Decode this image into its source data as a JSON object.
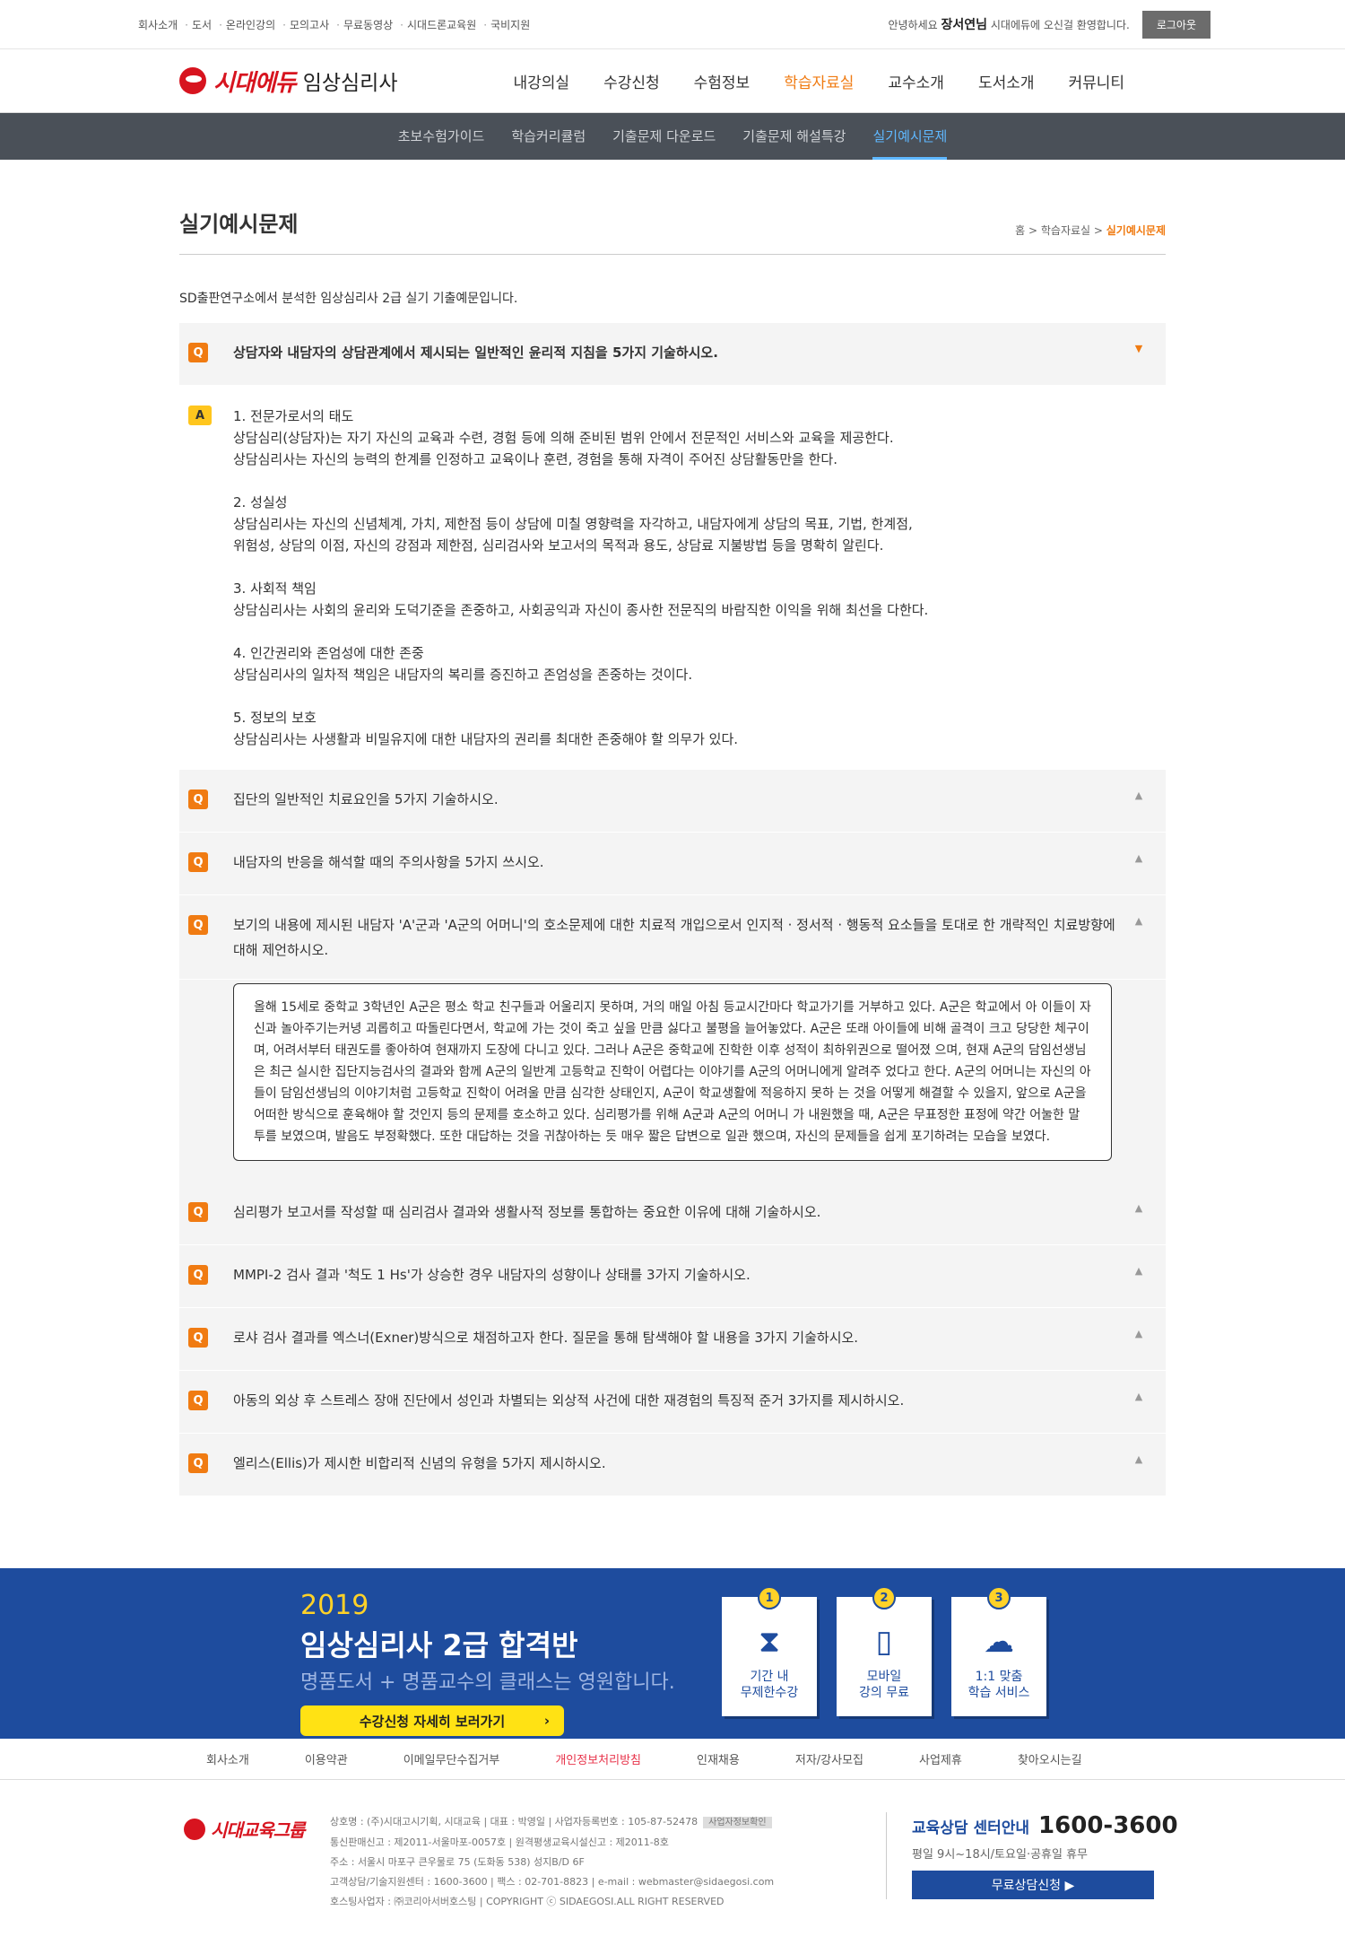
{
  "topbar": {
    "links": [
      "회사소개",
      "도서",
      "온라인강의",
      "모의고사",
      "무료동영상",
      "시대드론교육원",
      "국비지원"
    ],
    "greeting_pre": "안녕하세요",
    "user_name": "장서연님",
    "greeting_post": "시대에듀에 오신걸 환영합니다.",
    "logout_label": "로그아웃"
  },
  "header": {
    "logo_text": "시대에듀",
    "logo_sub": "임상심리사",
    "menu": [
      "내강의실",
      "수강신청",
      "수험정보",
      "학습자료실",
      "교수소개",
      "도서소개",
      "커뮤니티"
    ]
  },
  "subnav": [
    "초보수험가이드",
    "학습커리큘럼",
    "기출문제 다운로드",
    "기출문제 해설특강",
    "실기예시문제"
  ],
  "page": {
    "title": "실기예시문제",
    "breadcrumb": [
      "홈",
      "학습자료실",
      "실기예시문제"
    ],
    "intro": "SD출판연구소에서 분석한 임상심리사 2급 실기 기출예문입니다."
  },
  "faq": {
    "q_badge": "Q",
    "a_badge": "A",
    "open_arrow": "▼",
    "closed_arrow": "▲",
    "items": [
      {
        "q": "상담자와 내담자의 상담관계에서 제시되는 일반적인 윤리적 지침을 5가지 기술하시오."
      },
      {
        "q": "집단의 일반적인 치료요인을 5가지 기술하시오."
      },
      {
        "q": "내담자의 반응을 해석할 때의 주의사항을 5가지 쓰시오."
      },
      {
        "q": "보기의 내용에 제시된 내담자 'A'군과 'A군의 어머니'의 호소문제에 대한 치료적 개입으로서 인지적 · 정서적 · 행동적 요소들을 토대로 한 개략적인 치료방향에 대해 제언하시오."
      },
      {
        "q": "심리평가 보고서를 작성할 때 심리검사 결과와 생활사적 정보를 통합하는 중요한 이유에 대해 기술하시오."
      },
      {
        "q": "MMPI-2 검사 결과 '척도 1 Hs'가 상승한 경우 내담자의 성향이나 상태를 3가지 기술하시오."
      },
      {
        "q": "로샤 검사 결과를 엑스너(Exner)방식으로 채점하고자 한다. 질문을 통해 탐색해야 할 내용을 3가지 기술하시오."
      },
      {
        "q": "아동의 외상 후 스트레스 장애 진단에서 성인과 차별되는 외상적 사건에 대한 재경험의 특징적 준거 3가지를 제시하시오."
      },
      {
        "q": "엘리스(Ellis)가 제시한 비합리적 신념의 유형을 5가지 제시하시오."
      }
    ],
    "answer": [
      {
        "h": "1. 전문가로서의 태도",
        "lines": [
          "상담심리(상담자)는 자기 자신의 교육과 수련, 경험 등에 의해 준비된 범위 안에서 전문적인 서비스와 교육을 제공한다.",
          "상담심리사는 자신의 능력의 한계를 인정하고 교육이나 훈련, 경험을 통해 자격이 주어진 상담활동만을 한다."
        ]
      },
      {
        "h": "2. 성실성",
        "lines": [
          "상담심리사는 자신의 신념체계, 가치, 제한점 등이 상담에 미칠 영향력을 자각하고, 내담자에게 상담의 목표, 기법, 한계점,",
          "위험성, 상담의 이점, 자신의 강점과 제한점, 심리검사와 보고서의 목적과 용도, 상담료 지불방법 등을 명확히 알린다."
        ]
      },
      {
        "h": "3. 사회적 책임",
        "lines": [
          "상담심리사는 사회의 윤리와 도덕기준을 존중하고, 사회공익과 자신이 종사한 전문직의 바람직한 이익을 위해 최선을 다한다."
        ]
      },
      {
        "h": "4. 인간권리와 존엄성에 대한 존중",
        "lines": [
          "상담심리사의 일차적 책임은 내담자의 복리를 증진하고 존엄성을 존중하는 것이다."
        ]
      },
      {
        "h": "5. 정보의 보호",
        "lines": [
          "상담심리사는 사생활과 비밀유지에 대한 내담자의 권리를 최대한 존중해야 할 의무가 있다."
        ]
      }
    ],
    "case_lines": [
      "올해 15세로 중학교 3학년인 A군은 평소 학교 친구들과 어울리지 못하며, 거의 매일 아침 등교시간마다 학교가기를 거부하고 있다. A군은 학교에서 아",
      "이들이 자신과 놀아주기는커녕 괴롭히고 따돌린다면서, 학교에 가는 것이 죽고 싶을 만큼 싫다고 불평을 늘어놓았다. A군은 또래 아이들에 비해 골격이",
      "크고 당당한 체구이며, 어려서부터 태권도를 좋아하여 현재까지 도장에 다니고 있다. 그러나 A군은 중학교에 진학한 이후 성적이 최하위권으로 떨어졌",
      "으며, 현재 A군의 담임선생님은 최근 실시한 집단지능검사의 결과와 함께 A군의 일반계 고등학교 진학이 어렵다는 이야기를 A군의 어머니에게 알려주",
      "었다고 한다. A군의 어머니는 자신의 아들이 담임선생님의 이야기처럼 고등학교 진학이 어려울 만큼 심각한 상태인지, A군이 학교생활에 적응하지 못하",
      "는 것을 어떻게 해결할 수 있을지, 앞으로 A군을 어떠한 방식으로 훈육해야 할 것인지 등의 문제를 호소하고 있다. 심리평가를 위해 A군과 A군의 어머니",
      "가 내원했을 때, A군은 무표정한 표정에 약간 어눌한 말투를 보였으며, 발음도 부정확했다. 또한 대답하는 것을 귀찮아하는 듯 매우 짧은 답변으로 일관",
      "했으며, 자신의 문제들을 쉽게 포기하려는 모습을 보였다."
    ]
  },
  "banner": {
    "year": "2019",
    "title": "임상심리사 2급 합격반",
    "sub": "명품도서 + 명품교수의 클래스는 영원합니다.",
    "button": "수강신청 자세히 보러가기",
    "button_arrow": "›",
    "cards": [
      {
        "num": "1",
        "icon": "hourglass-icon",
        "glyph": "⧗",
        "l1": "기간 내",
        "l2": "무제한수강"
      },
      {
        "num": "2",
        "icon": "mobile-icon",
        "glyph": "▯",
        "l1": "모바일",
        "l2": "강의 무료"
      },
      {
        "num": "3",
        "icon": "cloud-icon",
        "glyph": "☁",
        "l1": "1:1 맞춤",
        "l2": "학습 서비스"
      }
    ]
  },
  "footer_nav": [
    "회사소개",
    "이용약관",
    "이메일무단수집거부",
    "개인정보처리방침",
    "인재채용",
    "저자/강사모집",
    "사업제휴",
    "찾아오시는길"
  ],
  "footer": {
    "logo": "시대교육그룹",
    "info": [
      "상호명 : (주)시대고시기획, 시대교육 | 대표 : 박영일 | 사업자등록번호 : 105-87-52478",
      "통신판매신고 : 제2011-서울마포-0057호 | 원격평생교육시설신고 : 제2011-8호",
      "주소 : 서울시 마포구 큰우물로 75 (도화동 538) 성지B/D 6F",
      "고객상담/기술지원센터 : 1600-3600 | 팩스 : 02-701-8823 | e-mail : webmaster@sidaegosi.com",
      "호스팅사업자 : ㈜코리아서버호스팅 | COPYRIGHT ⓒ SIDAEGOSI.ALL RIGHT RESERVED"
    ],
    "biz_tag": "사업자정보확인",
    "cs_title": "교육상담 센터안내",
    "cs_phone": "1600-3600",
    "cs_hours": "평일 9시~18시/토요일·공휴일 휴무",
    "cs_button": "무료상담신청 ▶"
  },
  "colors": {
    "accent": "#f07b12",
    "subnav_bg": "#4a5058",
    "banner_bg": "#1e4c9e",
    "answer_badge": "#ffc61e"
  }
}
